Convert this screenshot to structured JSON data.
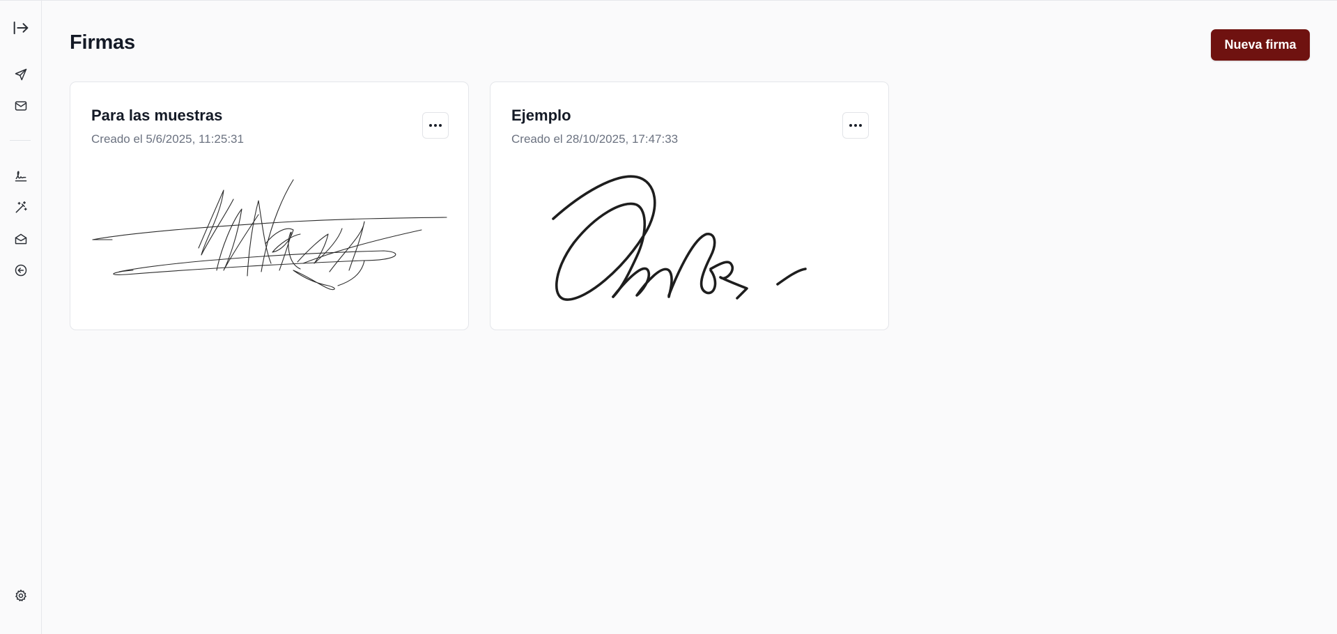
{
  "sidebar": {
    "items": [
      {
        "name": "toggle-sidebar",
        "icon": "arrow-right-to-line-icon"
      },
      {
        "name": "send",
        "icon": "send-icon"
      },
      {
        "name": "mail",
        "icon": "mail-icon"
      },
      {
        "name": "signature",
        "icon": "signature-icon"
      },
      {
        "name": "magic-wand",
        "icon": "magic-wand-icon"
      },
      {
        "name": "mail-open",
        "icon": "mail-open-icon"
      },
      {
        "name": "back",
        "icon": "circle-arrow-left-icon"
      },
      {
        "name": "settings",
        "icon": "gear-icon"
      }
    ]
  },
  "header": {
    "title": "Firmas",
    "new_button_label": "Nueva firma"
  },
  "signatures": [
    {
      "title": "Para las muestras",
      "created": "Creado el 5/6/2025, 11:25:31",
      "menu_icon": "more-horizontal-icon"
    },
    {
      "title": "Ejemplo",
      "created": "Creado el 28/10/2025, 17:47:33",
      "menu_icon": "more-horizontal-icon"
    }
  ],
  "colors": {
    "primary": "#6f1210",
    "background": "#fafafb",
    "card": "#ffffff",
    "text": "#141a26",
    "muted": "#6b7280"
  }
}
